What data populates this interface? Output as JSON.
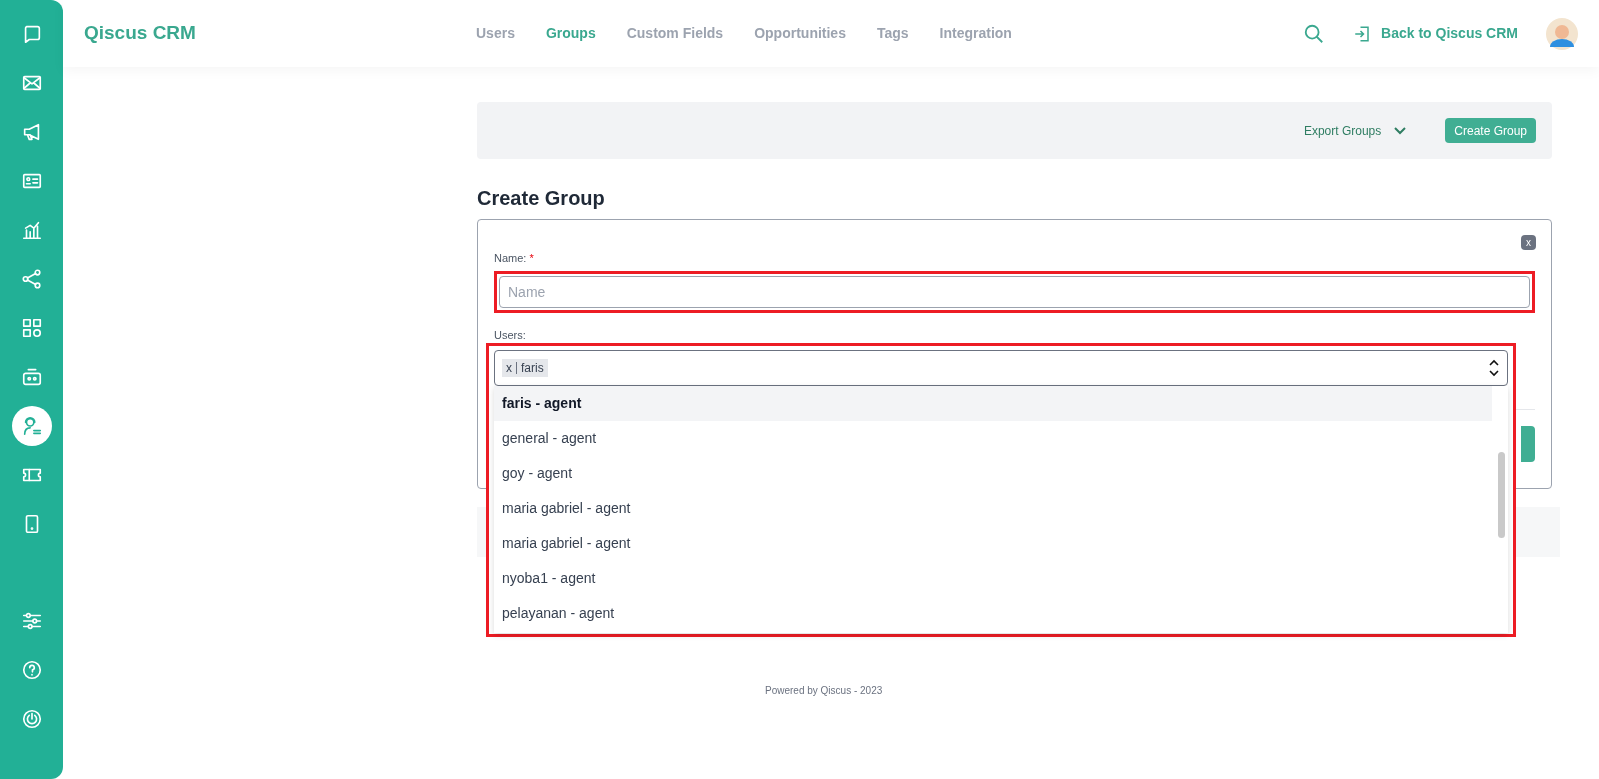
{
  "sidebar": {
    "items": [
      {
        "selected": false
      },
      {
        "selected": false
      },
      {
        "selected": false
      },
      {
        "selected": false
      },
      {
        "selected": false
      },
      {
        "selected": false
      },
      {
        "selected": false
      },
      {
        "selected": false
      },
      {
        "selected": true
      },
      {
        "selected": false
      },
      {
        "selected": false
      }
    ]
  },
  "header": {
    "logo": "Qiscus CRM",
    "tabs": [
      {
        "label": "Users",
        "selected": false
      },
      {
        "label": "Groups",
        "selected": true
      },
      {
        "label": "Custom Fields",
        "selected": false
      },
      {
        "label": "Opportunities",
        "selected": false
      },
      {
        "label": "Tags",
        "selected": false
      },
      {
        "label": "Integration",
        "selected": false
      }
    ],
    "back_link": "Back to Qiscus CRM"
  },
  "toolbar": {
    "export": "Export Groups",
    "create": "Create Group"
  },
  "form": {
    "title": "Create Group",
    "close": "x",
    "name_label": "Name:",
    "required_mark": "*",
    "name_placeholder": "Name",
    "users_label": "Users:",
    "chips": [
      {
        "remove": "x",
        "label": "faris"
      }
    ],
    "options": [
      {
        "label": "faris - agent",
        "selected": true
      },
      {
        "label": "general - agent",
        "selected": false
      },
      {
        "label": "goy - agent",
        "selected": false
      },
      {
        "label": "maria gabriel - agent",
        "selected": false
      },
      {
        "label": "maria gabriel - agent",
        "selected": false
      },
      {
        "label": "nyoba1 - agent",
        "selected": false
      },
      {
        "label": "pelayanan - agent",
        "selected": false
      }
    ]
  },
  "footer": "Powered by Qiscus - 2023"
}
